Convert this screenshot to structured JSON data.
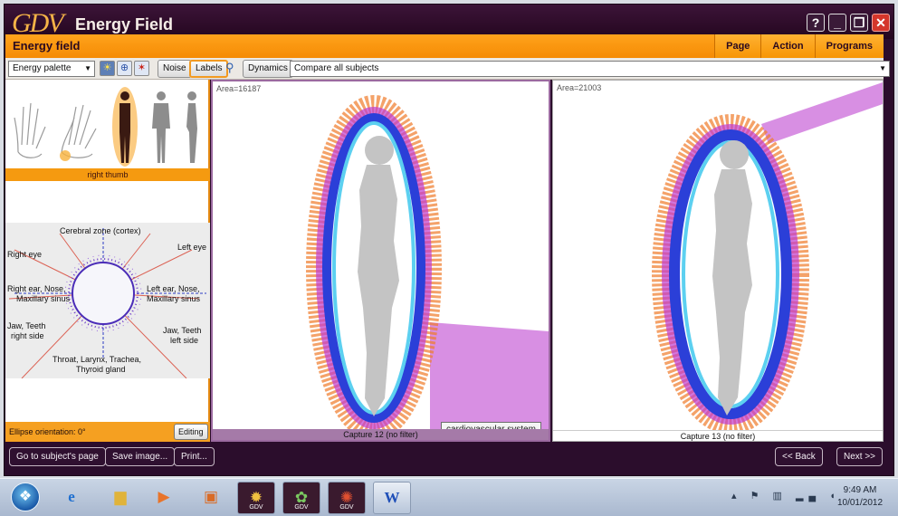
{
  "window": {
    "logo": "GDV",
    "title": "Energy Field",
    "controls": [
      "?",
      "_",
      "❐",
      "✕"
    ]
  },
  "menubar": {
    "page_title": "Energy field",
    "menus": [
      "Page",
      "Action",
      "Programs"
    ]
  },
  "toolbar": {
    "palette_select": "Energy palette",
    "noise_label": "Noise",
    "labels_label": "Labels",
    "dynamics_label": "Dynamics",
    "compare_select": "Compare all subjects"
  },
  "left_panel": {
    "finger_icons": [
      "left-hand-icon",
      "right-hand-icon",
      "body-front-highlighted-icon",
      "body-front-icon",
      "body-side-icon"
    ],
    "selected_finger": "right thumb",
    "diagram_labels": {
      "top": "Cerebral zone (cortex)",
      "right_eye": "Right eye",
      "left_eye": "Left eye",
      "right_ear": "Right ear, Nose,",
      "right_sinus": "Maxillary sinus",
      "left_ear": "Left ear, Nose,",
      "left_sinus": "Maxillary sinus",
      "jaw_right_1": "Jaw, Teeth",
      "jaw_right_2": "right side",
      "jaw_left_1": "Jaw, Teeth",
      "jaw_left_2": "left side",
      "throat_1": "Throat, Larynx, Trachea,",
      "throat_2": "Thyroid gland"
    },
    "ellipse_orientation": "Ellipse orientation: 0°",
    "editing_label": "Editing"
  },
  "captures": [
    {
      "area": "Area=16187",
      "caption": "Capture 12 (no filter)",
      "tooltip": "cardiovascular system",
      "highlight_color": "#d88fe3"
    },
    {
      "area": "Area=21003",
      "caption": "Capture 13 (no filter)",
      "highlight_color": "#d88fe3"
    }
  ],
  "bottom_bar": {
    "goto_label": "Go to subject's page",
    "save_label": "Save image...",
    "print_label": "Print...",
    "back_label": "<< Back",
    "next_label": "Next >>"
  },
  "taskbar": {
    "apps": [
      "ie-icon",
      "folder-icon",
      "media-player-icon",
      "tool-icon",
      "gdv-app-icon",
      "gdv-app-icon",
      "gdv-app-icon",
      "word-icon"
    ],
    "gdv_sub": "GDV",
    "word_glyph": "W",
    "ie_glyph": "e",
    "time": "9:49 AM",
    "date": "10/01/2012"
  },
  "colors": {
    "window_bg": "#2b0d2c",
    "accent_orange": "#f58b04",
    "aura_blue": "#2b3fd8",
    "aura_orange": "#f07a2a",
    "highlight_violet": "#d88fe3"
  }
}
